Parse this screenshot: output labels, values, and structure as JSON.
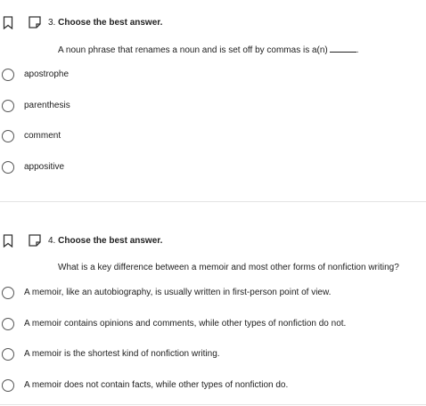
{
  "questions": [
    {
      "number": "3.",
      "instruction": "Choose the best answer.",
      "prompt": "A noun phrase that renames a noun and is set off by commas is a(n)",
      "blank_suffix": ".",
      "options": [
        "apostrophe",
        "parenthesis",
        "comment",
        "appositive"
      ]
    },
    {
      "number": "4.",
      "instruction": "Choose the best answer.",
      "prompt": "What is a key difference between a memoir and most other forms of nonfiction writing?",
      "options": [
        "A memoir, like an autobiography, is usually written in first-person point of view.",
        "A memoir contains opinions and comments, while other types of nonfiction do not.",
        "A memoir is the shortest kind of nonfiction writing.",
        "A memoir does not contain facts, while other types of nonfiction do."
      ]
    }
  ],
  "icons": {
    "bookmark": "bookmark-icon",
    "note": "note-icon",
    "radio": "radio-button"
  },
  "colors": {
    "text": "#212121",
    "divider": "#e3e3e3",
    "radio_border": "#555555"
  }
}
